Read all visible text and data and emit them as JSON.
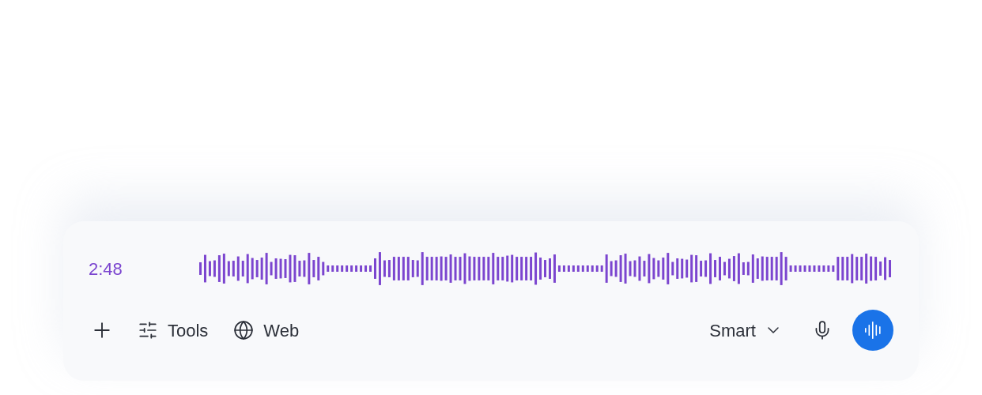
{
  "recording": {
    "elapsed": "2:48"
  },
  "toolbar": {
    "left_buttons": [
      {
        "kind": "tools",
        "label": "Tools"
      },
      {
        "kind": "web",
        "label": "Web"
      }
    ],
    "model_selector": {
      "label": "Smart"
    }
  }
}
